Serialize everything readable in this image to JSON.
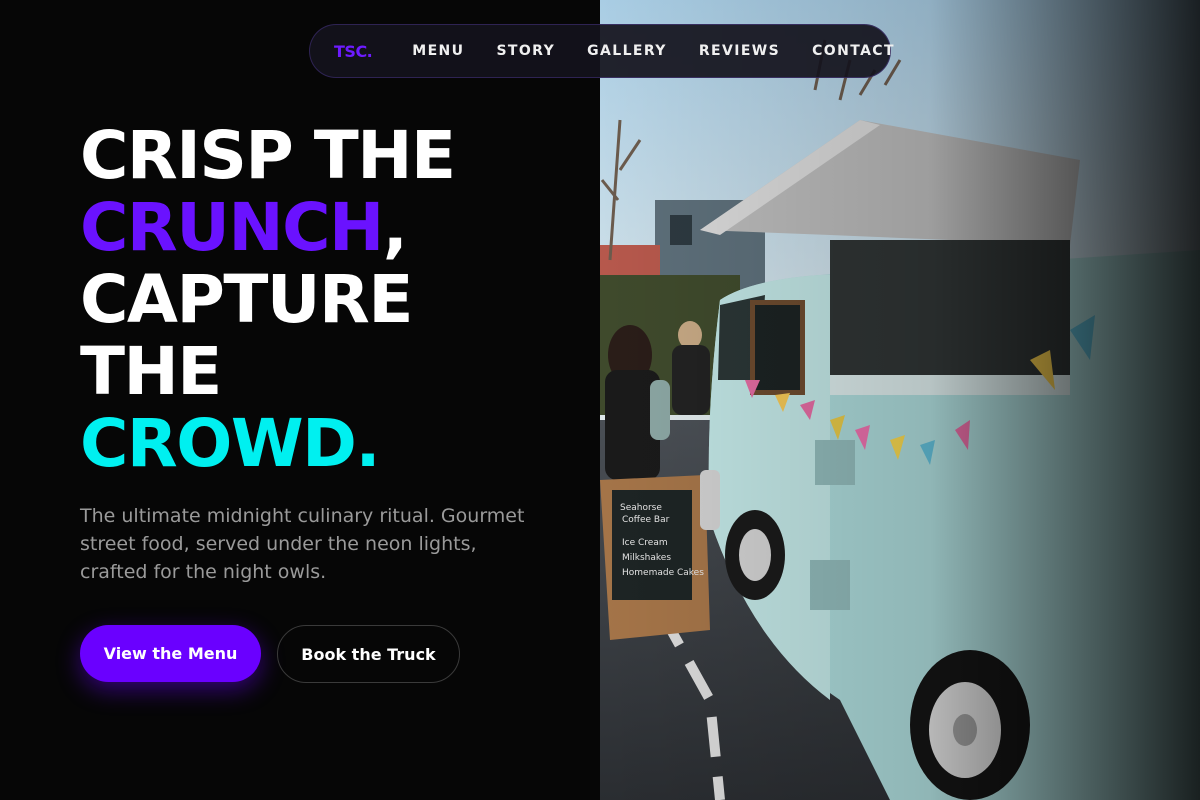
{
  "nav": {
    "logo": "TSC.",
    "links": [
      "MENU",
      "STORY",
      "GALLERY",
      "REVIEWS",
      "CONTACT"
    ]
  },
  "hero": {
    "headline": {
      "line1": "CRISP THE",
      "line2_accent": "CRUNCH",
      "line2_rest": ",",
      "line3": "CAPTURE",
      "line4": "THE",
      "line5_accent": "CROWD."
    },
    "subtitle": "The ultimate midnight culinary ritual. Gourmet street food, served under the neon lights, crafted for the night owls.",
    "primary_button": "View the Menu",
    "secondary_button": "Book the Truck"
  },
  "colors": {
    "accent_purple": "#6a12ff",
    "accent_cyan": "#00f0f0",
    "background": "#060606"
  }
}
